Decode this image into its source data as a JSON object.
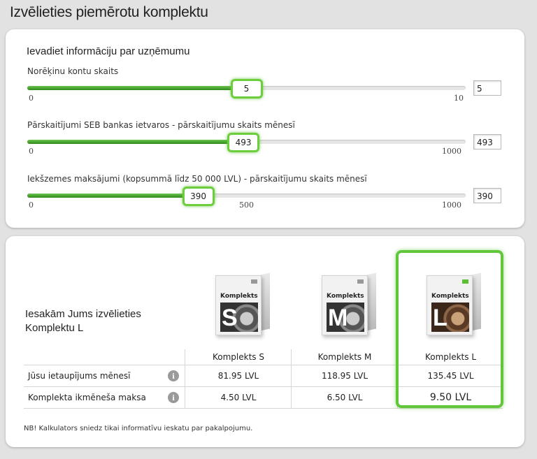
{
  "header": {
    "title": "Izvēlieties piemērotu komplektu"
  },
  "inputs_section": {
    "title": "Ievadiet informāciju par uzņēmumu",
    "sliders": [
      {
        "label": "Norēķinu kontu skaits",
        "value": "5",
        "fraction": 0.5,
        "ticks": [
          "0",
          "5",
          "10"
        ]
      },
      {
        "label": "Pārskaitījumi SEB bankas ietvaros - pārskaitījumu skaits mēnesī",
        "value": "493",
        "fraction": 0.493,
        "ticks": [
          "0",
          "500",
          "1000"
        ]
      },
      {
        "label": "Iekšzemes maksājumi (kopsummā līdz 50 000 LVL) - pārskaitījumu skaits mēnesī",
        "value": "390",
        "fraction": 0.39,
        "ticks": [
          "0",
          "500",
          "1000"
        ]
      }
    ]
  },
  "recommendation": {
    "line1": "Iesakām Jums izvēlieties",
    "line2": "Komplektu L"
  },
  "packages": [
    {
      "box_label": "Komplekts",
      "letter": "S",
      "name": "Komplekts S",
      "savings": "81.95 LVL",
      "monthly_fee": "4.50 LVL"
    },
    {
      "box_label": "Komplekts",
      "letter": "M",
      "name": "Komplekts M",
      "savings": "118.95 LVL",
      "monthly_fee": "6.50 LVL"
    },
    {
      "box_label": "Komplekts",
      "letter": "L",
      "name": "Komplekts L",
      "savings": "135.45 LVL",
      "monthly_fee": "9.50 LVL"
    }
  ],
  "table": {
    "row_labels": [
      "Jūsu ietaupījums mēnesī",
      "Komplekta ikmēneša maksa"
    ]
  },
  "note": "NB! Kalkulators sniedz tikai informatīvu ieskatu par pakalpojumu.",
  "colors": {
    "accent_green": "#62c63b",
    "slider_fill": "#3f9a25"
  }
}
